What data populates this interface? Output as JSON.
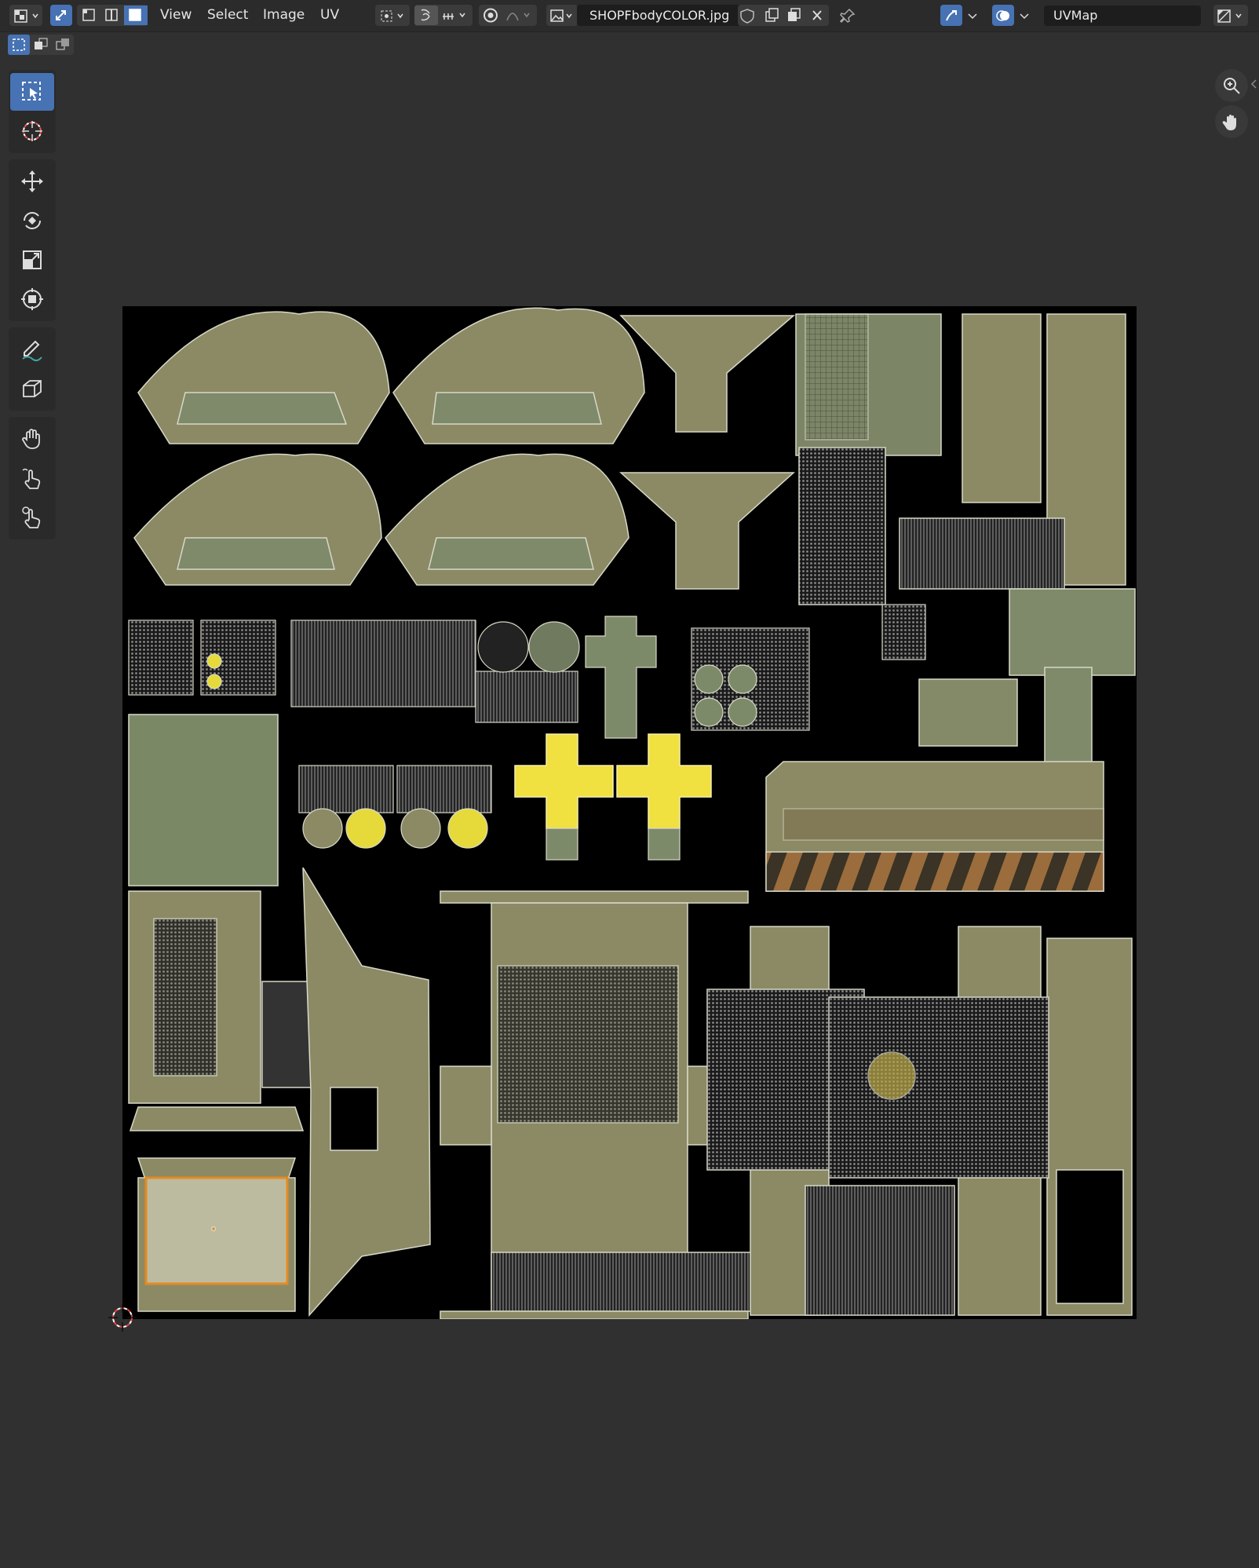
{
  "header": {
    "menus": [
      {
        "id": "view",
        "label": "View"
      },
      {
        "id": "select",
        "label": "Select"
      },
      {
        "id": "image",
        "label": "Image"
      },
      {
        "id": "uv",
        "label": "UV"
      }
    ],
    "image_name": "SHOPFbodyCOLOR.jpg",
    "uv_map": "UVMap"
  },
  "toolbar": {
    "tools": [
      {
        "name": "select-box",
        "icon": "select-box-icon",
        "active": true
      },
      {
        "name": "cursor",
        "icon": "cursor-icon",
        "active": false
      },
      {
        "name": "move",
        "icon": "move-icon",
        "active": false
      },
      {
        "name": "rotate",
        "icon": "rotate-icon",
        "active": false
      },
      {
        "name": "scale",
        "icon": "scale-icon",
        "active": false
      },
      {
        "name": "transform",
        "icon": "transform-icon",
        "active": false
      },
      {
        "name": "annotate",
        "icon": "annotate-icon",
        "active": false
      },
      {
        "name": "rip",
        "icon": "rip-icon",
        "active": false
      },
      {
        "name": "grab",
        "icon": "grab-icon",
        "active": false
      },
      {
        "name": "relax",
        "icon": "relax-icon",
        "active": false
      },
      {
        "name": "pinch",
        "icon": "pinch-icon",
        "active": false
      }
    ]
  },
  "colors": {
    "accent": "#4772b3",
    "header_bg": "#2b2b2b",
    "editor_bg": "#303030",
    "texture_panel": "#8a8c6a",
    "selected_face": "#f0e040"
  }
}
